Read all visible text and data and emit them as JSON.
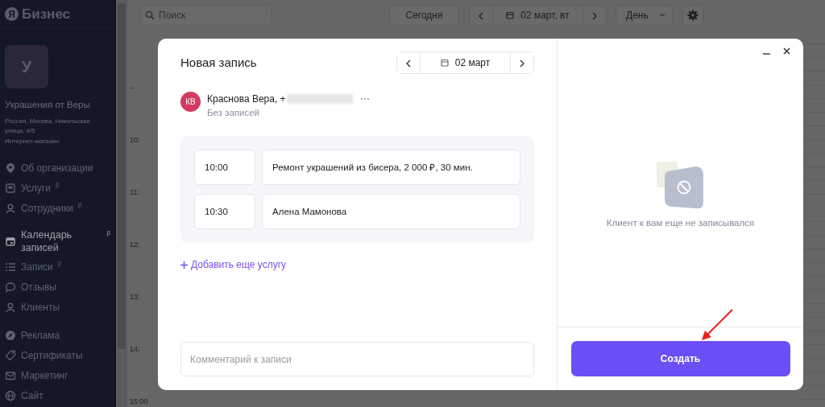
{
  "sidebar": {
    "logo": {
      "mark": "Я",
      "text": "Бизнес"
    },
    "organization": {
      "avatar": "У",
      "name": "Украшения от Веры",
      "address": "Россия, Москва, Никольская улица, 4/5",
      "category": "Интернет-магазин"
    },
    "groups": [
      {
        "items": [
          {
            "kind": "pin",
            "label": "Об организации",
            "selected": false
          },
          {
            "kind": "box",
            "label": "Услуги",
            "badge": "β",
            "selected": false
          },
          {
            "kind": "person",
            "label": "Сотрудники",
            "badge": "β",
            "selected": false
          }
        ]
      },
      {
        "items": [
          {
            "kind": "calendar",
            "label": "Календарь записей",
            "badge": "β",
            "selected": true
          },
          {
            "kind": "list",
            "label": "Записи",
            "badge": "β",
            "selected": false
          },
          {
            "kind": "chat",
            "label": "Отзывы",
            "selected": false
          },
          {
            "kind": "person",
            "label": "Клиенты",
            "selected": false
          }
        ]
      },
      {
        "items": [
          {
            "kind": "rocket",
            "label": "Реклама",
            "selected": false
          },
          {
            "kind": "tag",
            "label": "Сертификаты",
            "selected": false
          },
          {
            "kind": "mail",
            "label": "Маркетинг",
            "selected": false
          },
          {
            "kind": "globe",
            "label": "Сайт",
            "selected": false
          }
        ]
      }
    ]
  },
  "toolbar": {
    "search": {
      "placeholder": "Поиск"
    },
    "today_button": "Сегодня",
    "date": "02 март, вт",
    "view": "День"
  },
  "time_labels": [
    "--",
    "10:",
    "11:",
    "12:",
    "13:",
    "14:",
    "15:00"
  ],
  "modal": {
    "title": "Новая запись",
    "date": "02 март",
    "client": {
      "initials": "КВ",
      "name": "Краснова Вера, +",
      "status": "Без записей"
    },
    "services": [
      {
        "time": "10:00",
        "text": "Ремонт украшений из бисера, 2 000 ₽, 30 мин."
      },
      {
        "time": "10:30",
        "text": "Алена Мамонова"
      }
    ],
    "add_service": "Добавить еще услугу",
    "comment": {
      "placeholder": "Комментарий к записи"
    },
    "empty_text": "Клиент к вам еще не записывался",
    "create_button": "Создать"
  }
}
